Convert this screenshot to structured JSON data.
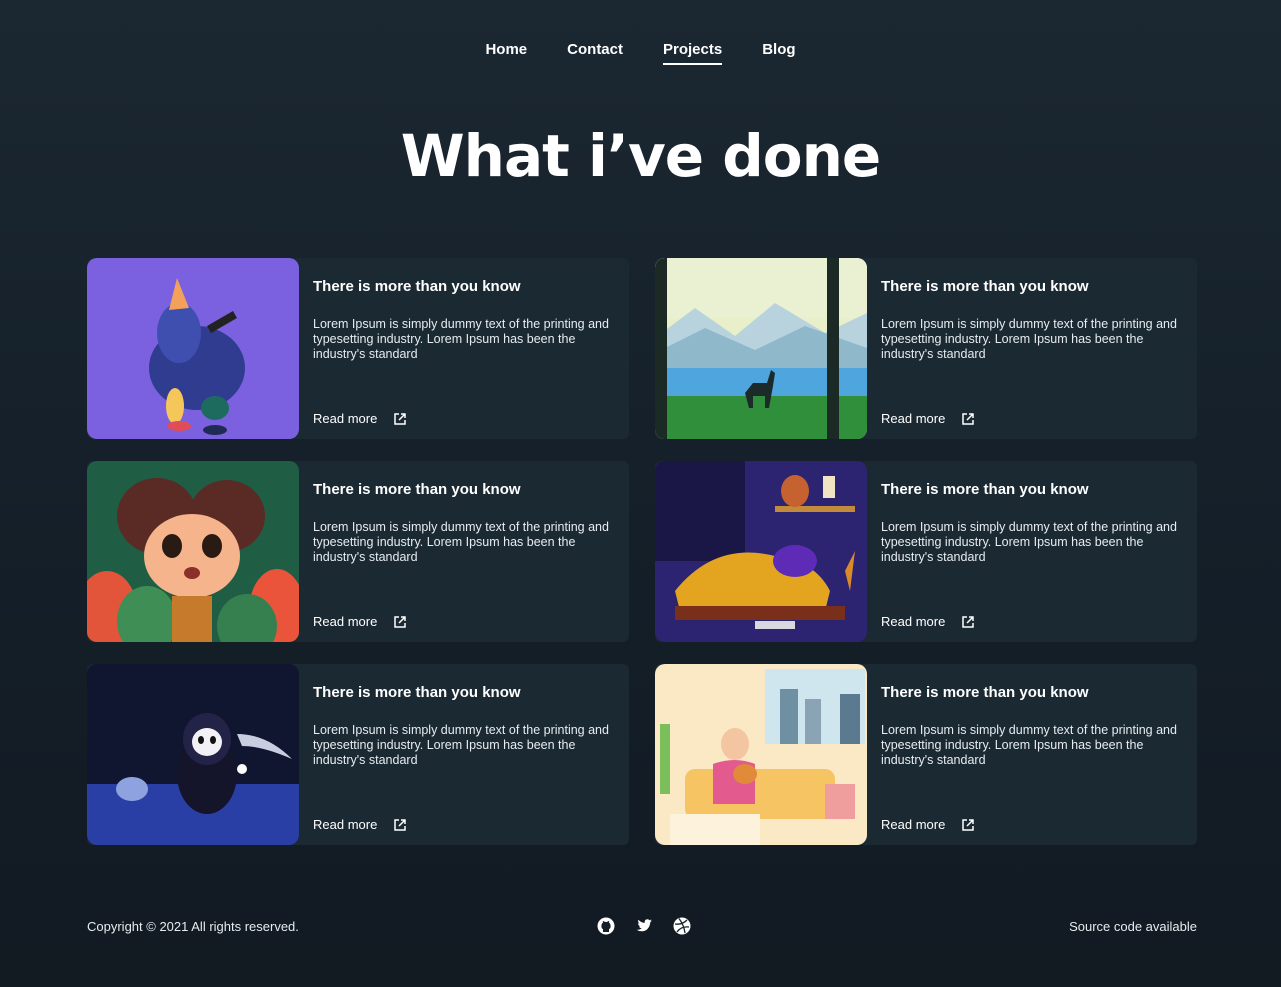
{
  "nav": {
    "items": [
      {
        "label": "Home",
        "active": false
      },
      {
        "label": "Contact",
        "active": false
      },
      {
        "label": "Projects",
        "active": true
      },
      {
        "label": "Blog",
        "active": false
      }
    ]
  },
  "page": {
    "title": "What i’ve done"
  },
  "cards": [
    {
      "title": "There is more than you know",
      "text": "Lorem Ipsum is simply dummy text of the printing and typesetting industry. Lorem Ipsum has been the industry's standard",
      "link": "Read more",
      "icon": "external-link-icon"
    },
    {
      "title": "There is more than you know",
      "text": "Lorem Ipsum is simply dummy text of the printing and typesetting industry. Lorem Ipsum has been the industry's standard",
      "link": "Read more",
      "icon": "external-link-icon"
    },
    {
      "title": "There is more than you know",
      "text": "Lorem Ipsum is simply dummy text of the printing and typesetting industry. Lorem Ipsum has been the industry's standard",
      "link": "Read more",
      "icon": "external-link-icon"
    },
    {
      "title": "There is more than you know",
      "text": "Lorem Ipsum is simply dummy text of the printing and typesetting industry. Lorem Ipsum has been the industry's standard",
      "link": "Read more",
      "icon": "external-link-icon"
    },
    {
      "title": "There is more than you know",
      "text": "Lorem Ipsum is simply dummy text of the printing and typesetting industry. Lorem Ipsum has been the industry's standard",
      "link": "Read more",
      "icon": "external-link-icon"
    },
    {
      "title": "There is more than you know",
      "text": "Lorem Ipsum is simply dummy text of the printing and typesetting industry. Lorem Ipsum has been the industry's standard",
      "link": "Read more",
      "icon": "external-link-icon"
    }
  ],
  "footer": {
    "copyright": "Copyright © 2021 All rights reserved.",
    "source": "Source code available",
    "socials": [
      "github-icon",
      "twitter-icon",
      "dribbble-icon"
    ]
  },
  "colors": {
    "background": "#15202a",
    "card": "#1b2933",
    "text": "#ffffff"
  }
}
